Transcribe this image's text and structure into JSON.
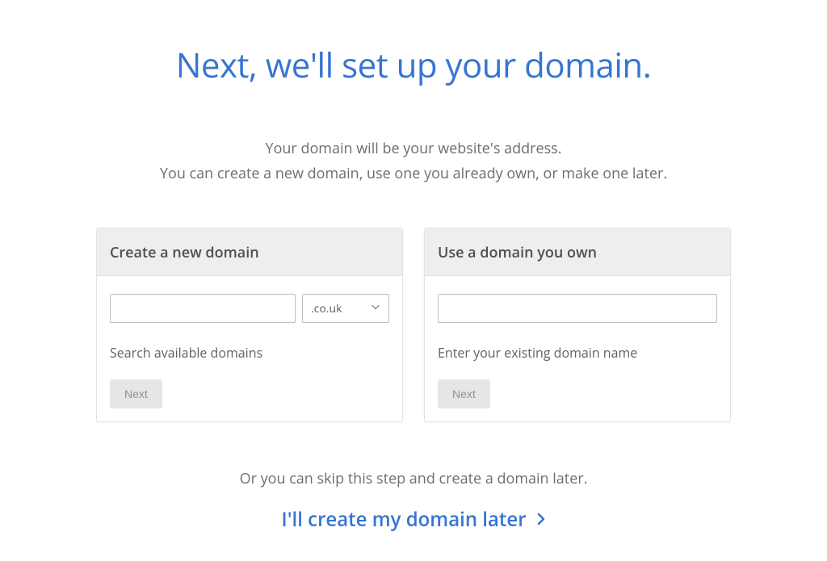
{
  "page": {
    "title": "Next, we'll set up your domain.",
    "subtitle_line1": "Your domain will be your website's address.",
    "subtitle_line2": "You can create a new domain, use one you already own, or make one later."
  },
  "cards": {
    "create": {
      "title": "Create a new domain",
      "input_value": "",
      "tld_selected": ".co.uk",
      "helper": "Search available domains",
      "button": "Next"
    },
    "own": {
      "title": "Use a domain you own",
      "input_value": "",
      "helper": "Enter your existing domain name",
      "button": "Next"
    }
  },
  "skip": {
    "text": "Or you can skip this step and create a domain later.",
    "link": "I'll create my domain later"
  },
  "colors": {
    "primary": "#3575d3",
    "muted_text": "#6a6e73",
    "card_header_bg": "#eeeeee"
  }
}
